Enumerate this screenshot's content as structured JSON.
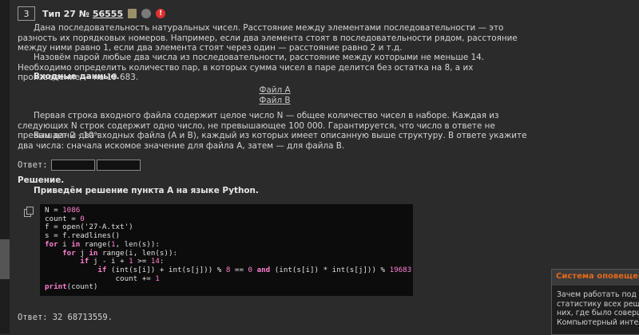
{
  "task": {
    "number": "3",
    "type_prefix": "Тип 27 № ",
    "id": "56555",
    "warn_glyph": "!"
  },
  "statement": {
    "p1": "Дана последовательность натуральных чисел. Расстояние между элементами последовательности — это разность их порядковых номеров. Например, если два элемента стоят в последовательности рядом, расстояние между ними равно 1, если два элемента стоят через один — расстояние равно 2 и т.д.",
    "p2": "Назовём парой любые два числа из последовательности, расстояние между которыми не меньше 14. Необходимо определить количество пар, в которых сумма чисел в паре делится без остатка на 8, а их произведение — на 19 683.",
    "input_heading": "Входные данные.",
    "file_a": "Файл A",
    "file_b": "Файл B",
    "p3": "Первая строка входного файла содержит целое число N — общее количество чисел в наборе. Каждая из следующих N строк содержит одно число, не превышающее 100 000. Гарантируется, что число в ответе не превышает 2 · 10⁹.",
    "p4": "Вам даны два входных файла (A и B), каждый из которых имеет описанную выше структуру. В ответе укажите два числа: сначала искомое значение для файла A, затем — для файла B."
  },
  "answer": {
    "label": "Ответ:",
    "field_a": "",
    "field_b": ""
  },
  "solution": {
    "heading": "Решение.",
    "intro": "Приведём решение пункта A на языке Python.",
    "code_lines": [
      "N = 1086",
      "count = 0",
      "f = open('27-A.txt')",
      "s = f.readlines()",
      "for i in range(1, len(s)):",
      "    for j in range(i, len(s)):",
      "        if j - i + 1 >= 14:",
      "            if (int(s[i]) + int(s[j])) % 8 == 0 and (int(s[i]) * int(s[j])) % 19683 == 0:",
      "                count += 1",
      "print(count)"
    ],
    "final_answer": "Ответ: 32 68713559."
  },
  "notification": {
    "title": "Система оповещени",
    "lines": [
      "Зачем работать под с",
      "статистику всех реше",
      "них, где было соверш",
      "Компьютерный интел"
    ]
  }
}
